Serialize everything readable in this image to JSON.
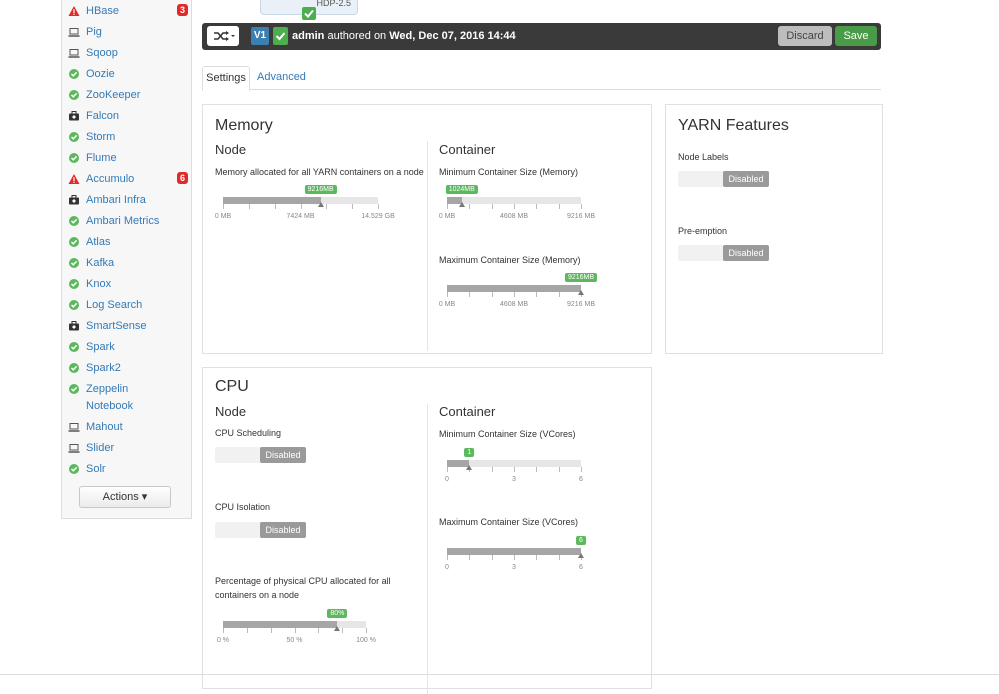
{
  "sidebar": {
    "items": [
      {
        "label": "HBase",
        "status": "alert",
        "badge": "3"
      },
      {
        "label": "Pig",
        "status": "client"
      },
      {
        "label": "Sqoop",
        "status": "client"
      },
      {
        "label": "Oozie",
        "status": "ok"
      },
      {
        "label": "ZooKeeper",
        "status": "ok"
      },
      {
        "label": "Falcon",
        "status": "maintenance"
      },
      {
        "label": "Storm",
        "status": "ok"
      },
      {
        "label": "Flume",
        "status": "ok"
      },
      {
        "label": "Accumulo",
        "status": "alert",
        "badge": "6"
      },
      {
        "label": "Ambari Infra",
        "status": "maintenance"
      },
      {
        "label": "Ambari Metrics",
        "status": "ok"
      },
      {
        "label": "Atlas",
        "status": "ok"
      },
      {
        "label": "Kafka",
        "status": "ok"
      },
      {
        "label": "Knox",
        "status": "ok"
      },
      {
        "label": "Log Search",
        "status": "ok"
      },
      {
        "label": "SmartSense",
        "status": "maintenance"
      },
      {
        "label": "Spark",
        "status": "ok"
      },
      {
        "label": "Spark2",
        "status": "ok"
      },
      {
        "label": "Zeppelin",
        "label2": "Notebook",
        "status": "ok"
      },
      {
        "label": "Mahout",
        "status": "client"
      },
      {
        "label": "Slider",
        "status": "client"
      },
      {
        "label": "Solr",
        "status": "ok"
      }
    ],
    "actions_label": "Actions ▾"
  },
  "version_card": {
    "label": "HDP-2.5"
  },
  "toolbar": {
    "version": "V1",
    "author": "admin",
    "authored_text": " authored on ",
    "date": "Wed, Dec 07, 2016 14:44",
    "discard_label": "Discard",
    "save_label": "Save"
  },
  "tabs": {
    "settings": "Settings",
    "advanced": "Advanced"
  },
  "memory": {
    "title": "Memory",
    "node_title": "Node",
    "node_label": "Memory allocated for all YARN containers on a node",
    "node_slider": {
      "value": "9216MB",
      "fraction": 0.63,
      "min": "0 MB",
      "mid": "7424 MB",
      "max": "14.529 GB"
    },
    "container_title": "Container",
    "min_label": "Minimum Container Size (Memory)",
    "min_slider": {
      "value": "1024MB",
      "fraction": 0.11,
      "min": "0 MB",
      "mid": "4608 MB",
      "max": "9216 MB"
    },
    "max_label": "Maximum Container Size (Memory)",
    "max_slider": {
      "value": "9216MB",
      "fraction": 1.0,
      "min": "0 MB",
      "mid": "4608 MB",
      "max": "9216 MB"
    }
  },
  "yarn_features": {
    "title": "YARN Features",
    "node_labels": "Node Labels",
    "node_labels_state": "Disabled",
    "preemption": "Pre-emption",
    "preemption_state": "Disabled"
  },
  "cpu": {
    "title": "CPU",
    "node_title": "Node",
    "scheduling_label": "CPU Scheduling",
    "scheduling_state": "Disabled",
    "isolation_label": "CPU Isolation",
    "isolation_state": "Disabled",
    "percent_label_1": "Percentage of physical CPU allocated for all",
    "percent_label_2": "containers on a node",
    "percent_slider": {
      "value": "80%",
      "fraction": 0.8,
      "min": "0 %",
      "mid": "50 %",
      "max": "100 %"
    },
    "container_title": "Container",
    "min_label": "Minimum Container Size (VCores)",
    "min_slider": {
      "value": "1",
      "fraction": 0.167,
      "min": "0",
      "mid": "3",
      "max": "6"
    },
    "max_label": "Maximum Container Size (VCores)",
    "max_slider": {
      "value": "6",
      "fraction": 1.0,
      "min": "0",
      "mid": "3",
      "max": "6"
    }
  },
  "colors": {
    "ok": "#5cb85c",
    "alert": "#e02a2a",
    "link": "#337ab7",
    "save": "#4a9b47",
    "toolbar": "#3a3a3a"
  }
}
